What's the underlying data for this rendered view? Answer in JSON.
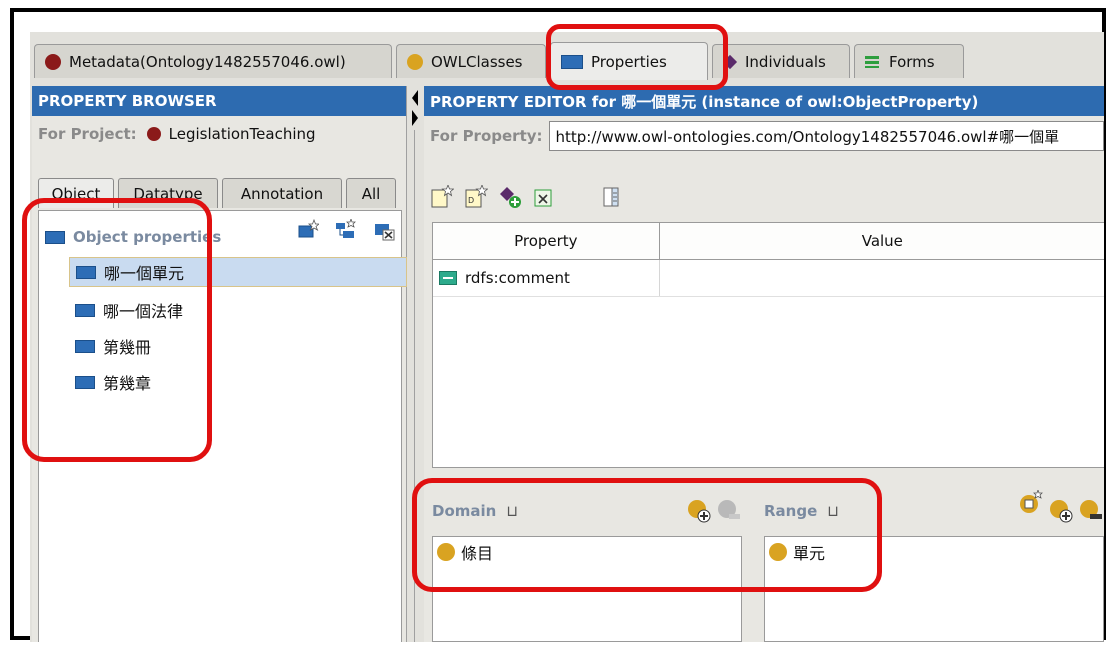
{
  "tabs": [
    {
      "label": "Metadata(Ontology1482557046.owl)",
      "icon": "maroon-circle-icon"
    },
    {
      "label": "OWLClasses",
      "icon": "yellow-circle-icon"
    },
    {
      "label": "Properties",
      "icon": "blue-rect-icon"
    },
    {
      "label": "Individuals",
      "icon": "purple-diamond-icon"
    },
    {
      "label": "Forms",
      "icon": "green-lines-icon"
    }
  ],
  "browser": {
    "title": "PROPERTY BROWSER",
    "project_label": "For Project:",
    "project_name": "LegislationTeaching",
    "subtabs": [
      "Object",
      "Datatype",
      "Annotation",
      "All"
    ],
    "header": "Object properties",
    "items": [
      "哪一個單元",
      "哪一個法律",
      "第幾冊",
      "第幾章"
    ]
  },
  "editor": {
    "title": "PROPERTY EDITOR for 哪一個單元   (instance of owl:ObjectProperty)",
    "property_label": "For Property:",
    "property_url": "http://www.owl-ontologies.com/Ontology1482557046.owl#哪一個單",
    "columns": [
      "Property",
      "Value"
    ],
    "rows": [
      {
        "property": "rdfs:comment",
        "value": ""
      }
    ],
    "domain_label": "Domain",
    "domain_items": [
      "條目"
    ],
    "range_label": "Range",
    "range_items": [
      "單元"
    ]
  },
  "colors": {
    "title_bar": "#2d6bb0",
    "annotation": "#e01010",
    "class_yellow": "#d9a321"
  }
}
